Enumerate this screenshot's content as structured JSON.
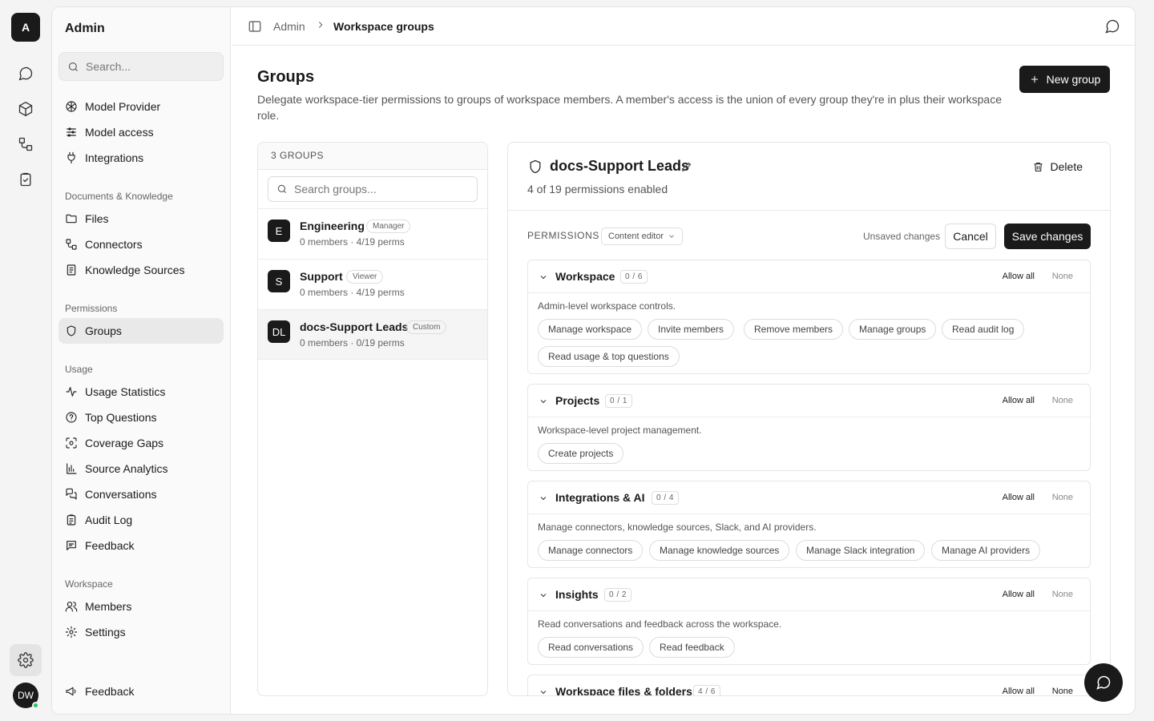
{
  "rail": {
    "logo": "A",
    "avatar": "DW"
  },
  "sidebar": {
    "title": "Admin",
    "search_placeholder": "Search...",
    "top_items": [
      {
        "label": "Model Provider",
        "icon": "model-provider-icon"
      },
      {
        "label": "Model access",
        "icon": "sliders-icon"
      },
      {
        "label": "Integrations",
        "icon": "plug-icon"
      }
    ],
    "sections": [
      {
        "title": "Documents & Knowledge",
        "items": [
          {
            "label": "Files",
            "icon": "folder-icon"
          },
          {
            "label": "Connectors",
            "icon": "connectors-icon"
          },
          {
            "label": "Knowledge Sources",
            "icon": "book-icon"
          }
        ]
      },
      {
        "title": "Permissions",
        "items": [
          {
            "label": "Groups",
            "icon": "shield-icon",
            "active": true
          }
        ]
      },
      {
        "title": "Usage",
        "items": [
          {
            "label": "Usage Statistics",
            "icon": "activity-icon"
          },
          {
            "label": "Top Questions",
            "icon": "question-icon"
          },
          {
            "label": "Coverage Gaps",
            "icon": "scan-icon"
          },
          {
            "label": "Source Analytics",
            "icon": "bar-chart-icon"
          },
          {
            "label": "Conversations",
            "icon": "messages-icon"
          },
          {
            "label": "Audit Log",
            "icon": "clipboard-icon"
          },
          {
            "label": "Feedback",
            "icon": "feedback-icon"
          }
        ]
      },
      {
        "title": "Workspace",
        "items": [
          {
            "label": "Members",
            "icon": "users-icon"
          },
          {
            "label": "Settings",
            "icon": "gear-icon"
          }
        ]
      }
    ],
    "footer_item": {
      "label": "Feedback",
      "icon": "megaphone-icon"
    }
  },
  "breadcrumb": {
    "parent": "Admin",
    "current": "Workspace groups"
  },
  "page": {
    "title": "Groups",
    "description": "Delegate workspace-tier permissions to groups of workspace members. A member's access is the union of every group they're in plus their workspace role.",
    "new_button": "New group"
  },
  "groups_list": {
    "header": "3 GROUPS",
    "search_placeholder": "Search groups...",
    "items": [
      {
        "initials": "E",
        "name": "Engineering",
        "badge": "Manager",
        "meta": "0 members · 4/19 perms"
      },
      {
        "initials": "S",
        "name": "Support",
        "badge": "Viewer",
        "meta": "0 members · 4/19 perms"
      },
      {
        "initials": "DL",
        "name": "docs-Support Leads",
        "badge": "Custom",
        "meta": "0 members · 0/19 perms",
        "selected": true
      }
    ]
  },
  "detail": {
    "title": "docs-Support Leads",
    "subtitle": "4 of 19 permissions enabled",
    "delete_label": "Delete",
    "permissions_label": "PERMISSIONS",
    "preset": "Content editor",
    "unsaved": "Unsaved changes",
    "cancel": "Cancel",
    "save": "Save changes",
    "allow_all": "Allow all",
    "none": "None",
    "categories": [
      {
        "name": "Workspace",
        "count": "0 / 6",
        "description": "Admin-level workspace controls.",
        "permissions": [
          "Manage workspace",
          "Invite members",
          "Remove members",
          "Manage groups",
          "Read audit log",
          "Read usage & top questions"
        ]
      },
      {
        "name": "Projects",
        "count": "0 / 1",
        "description": "Workspace-level project management.",
        "permissions": [
          "Create projects"
        ]
      },
      {
        "name": "Integrations & AI",
        "count": "0 / 4",
        "description": "Manage connectors, knowledge sources, Slack, and AI providers.",
        "permissions": [
          "Manage connectors",
          "Manage knowledge sources",
          "Manage Slack integration",
          "Manage AI providers"
        ]
      },
      {
        "name": "Insights",
        "count": "0 / 2",
        "description": "Read conversations and feedback across the workspace.",
        "permissions": [
          "Read conversations",
          "Read feedback"
        ]
      },
      {
        "name": "Workspace files & folders",
        "count": "4 / 6",
        "description": "",
        "permissions": []
      }
    ]
  }
}
